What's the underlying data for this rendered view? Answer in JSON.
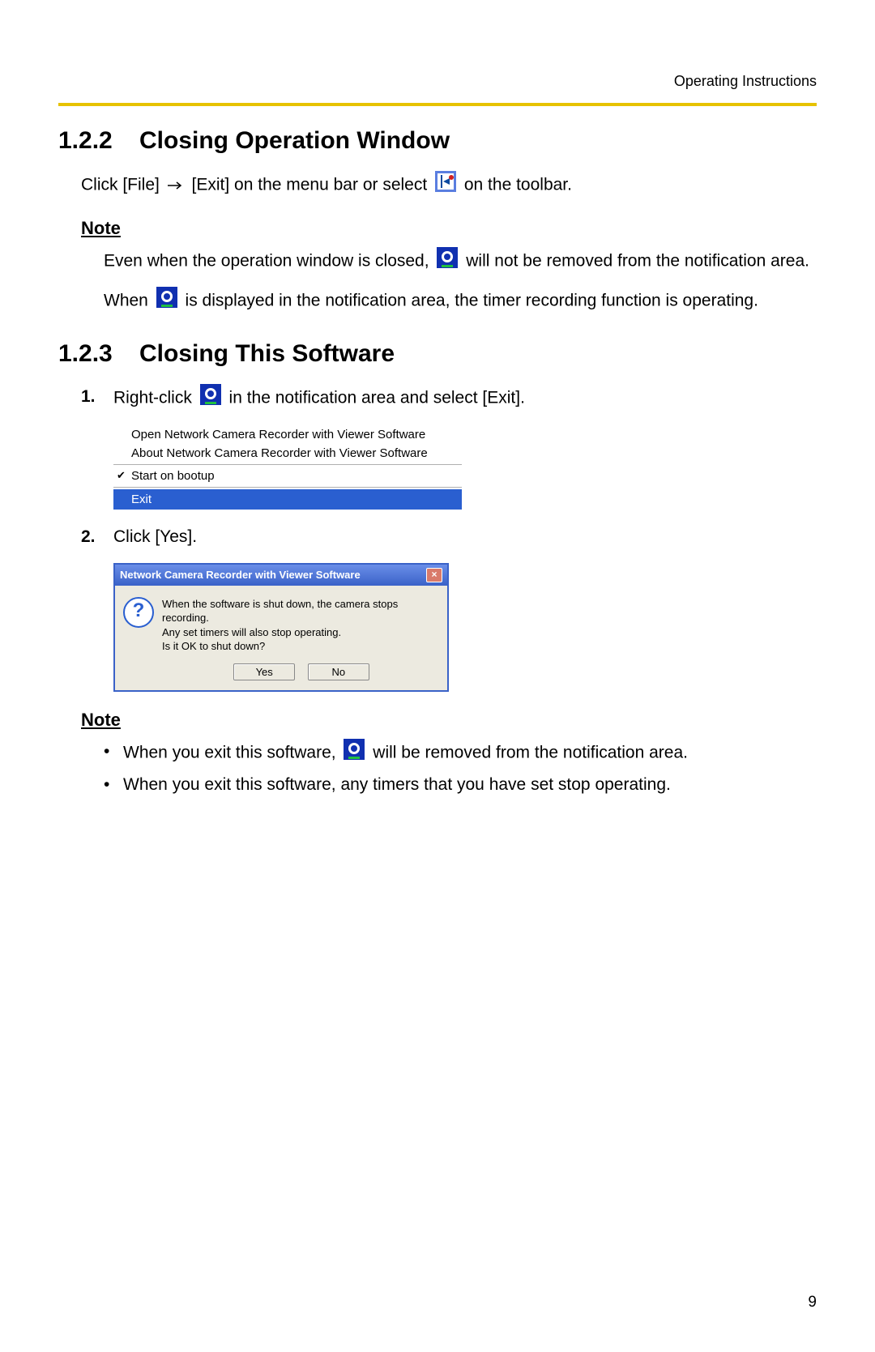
{
  "header": {
    "label": "Operating Instructions"
  },
  "sect122": {
    "num": "1.2.2",
    "title": "Closing Operation Window",
    "line_a": "Click [File] ",
    "line_b": " [Exit] on the menu bar or select ",
    "line_c": " on the toolbar.",
    "note_label": "Note",
    "note1_a": "Even when the operation window is closed, ",
    "note1_b": " will not be removed from the notification area.",
    "note2_a": "When ",
    "note2_b": " is displayed in the notification area, the timer recording function is operating."
  },
  "sect123": {
    "num": "1.2.3",
    "title": "Closing This Software",
    "step1_num": "1.",
    "step1_a": "Right-click ",
    "step1_b": " in the notification area and select [Exit].",
    "ctx": {
      "item1": "Open Network Camera Recorder with Viewer Software",
      "item2": "About Network Camera Recorder with Viewer Software",
      "item3": "Start on bootup",
      "item4": "Exit"
    },
    "step2_num": "2.",
    "step2": "Click [Yes].",
    "dlg": {
      "title": "Network Camera Recorder with Viewer Software",
      "line1": "When the software is shut down, the camera stops recording.",
      "line2": "Any set timers will also stop operating.",
      "line3": "Is it OK to shut down?",
      "yes": "Yes",
      "no": "No"
    },
    "note_label": "Note",
    "bullet1_a": "When you exit this software, ",
    "bullet1_b": " will be removed from the notification area.",
    "bullet2": "When you exit this software, any timers that you have set stop operating."
  },
  "page_number": "9"
}
